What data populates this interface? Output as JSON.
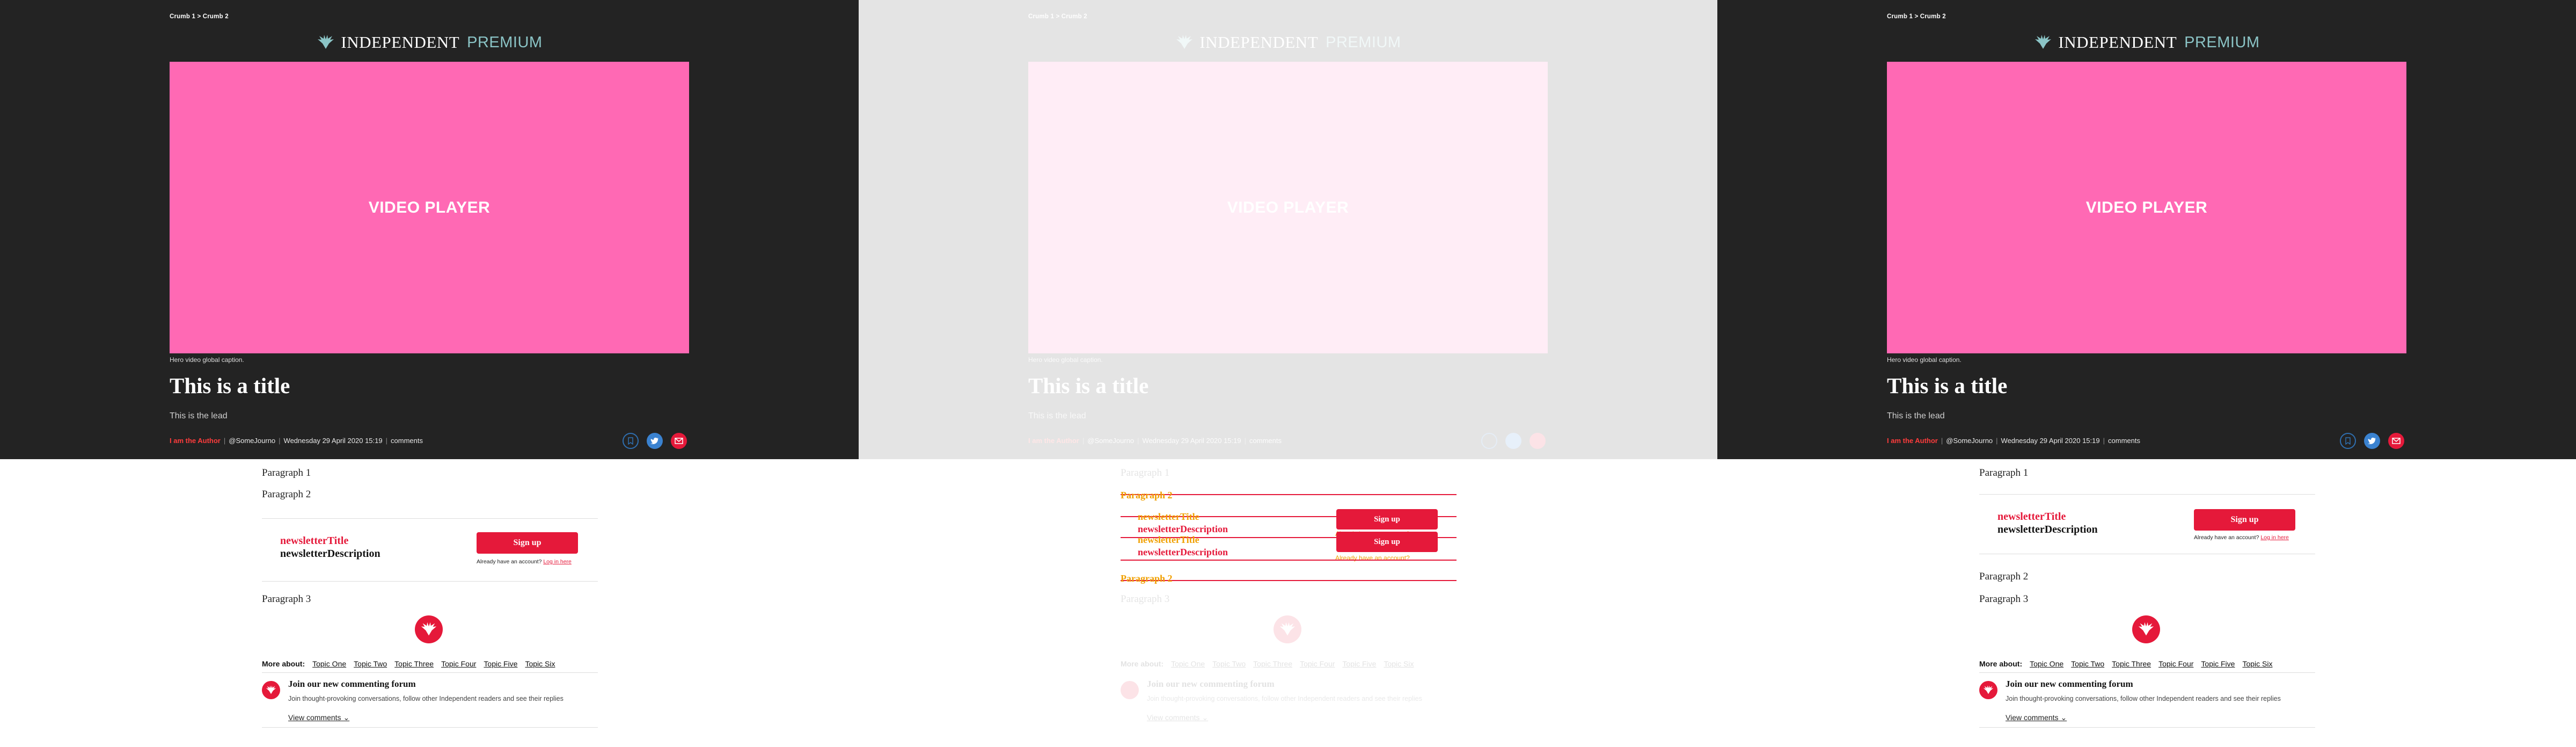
{
  "breadcrumb": "Crumb 1 > Crumb 2",
  "brand": {
    "name": "INDEPENDENT",
    "suffix": "PREMIUM",
    "accent": "#8bc4c6"
  },
  "video": {
    "label": "VIDEO PLAYER",
    "color": "#ff69b4",
    "caption": "Hero video global caption."
  },
  "article": {
    "title": "This is a title",
    "lead": "This is the lead",
    "author": "I am the Author",
    "handle": "@SomeJourno",
    "date": "Wednesday 29 April 2020 15:19",
    "comments_label": "comments"
  },
  "social": {
    "bookmark": "bookmark-icon",
    "twitter": "twitter-icon",
    "email": "email-icon"
  },
  "paragraphs": [
    "Paragraph 1",
    "Paragraph 2",
    "Paragraph 3"
  ],
  "newsletter": {
    "title": "newsletterTitle",
    "description": "newsletterDescription",
    "signup_label": "Sign up",
    "account_text": "Already have an account?",
    "login_link": "Log in here"
  },
  "more_about": {
    "label": "More about:",
    "topics": [
      "Topic One",
      "Topic Two",
      "Topic Three",
      "Topic Four",
      "Topic Five",
      "Topic Six"
    ]
  },
  "forum": {
    "title": "Join our new commenting forum",
    "description": "Join thought-provoking conversations, follow other Independent readers and see their replies",
    "view_comments": "View comments"
  },
  "colors": {
    "brand_red": "#e5193a",
    "hero_bg": "#232323"
  }
}
